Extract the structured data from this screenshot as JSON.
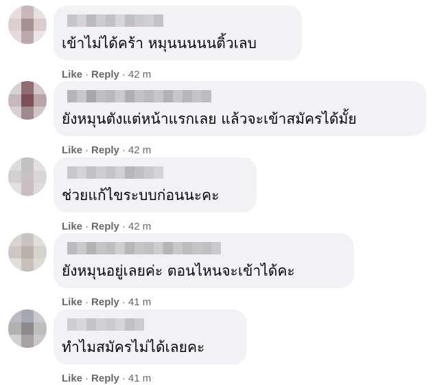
{
  "comments": [
    {
      "text": "เข้าไม่ได้คร้า หมุนนนนนติ้วเลบ",
      "like": "Like",
      "reply": "Reply",
      "time": "42 m",
      "avatar_colors": [
        "#e8dcdc",
        "#c9b7b9",
        "#e6e1e1",
        "#dccfd0",
        "#a78f94",
        "#d8cccd",
        "#e4dcdc",
        "#bca9ac",
        "#ebe6e6"
      ],
      "name_colors": [
        "#c8c4cc",
        "#d6d2d8",
        "#bcb8c2",
        "#cfcbd3",
        "#c4c0c8",
        "#d8d4da",
        "#c2bec6",
        "#cdc9cf",
        "#d3cfd6",
        "#c6c2ca"
      ]
    },
    {
      "text": "ยังหมุนตังแต่หน้าแรกเลย แล้วจะเข้าสมัครได้มั้ย",
      "like": "Like",
      "reply": "Reply",
      "time": "42 m",
      "avatar_colors": [
        "#d9d2d2",
        "#8f6b72",
        "#d1c8c9",
        "#c7b9bb",
        "#7c4f58",
        "#b7a5a8",
        "#d9d0d1",
        "#9e8a8e",
        "#cfc6c7"
      ],
      "name_colors": [
        "#b7b3bb",
        "#cac6ce",
        "#a9a5ad",
        "#c1bdc5",
        "#bbb7bf",
        "#ccc8d0",
        "#b1adb5",
        "#c4c0c8",
        "#bdb9c1",
        "#c8c4cc",
        "#b5b1b9",
        "#c9c5cd",
        "#b9b5bd",
        "#c6c2ca",
        "#bfbbc3"
      ]
    },
    {
      "text": "ช่วยแก้ไขระบบก่อนนะคะ",
      "like": "Like",
      "reply": "Reply",
      "time": "42 m",
      "avatar_colors": [
        "#dcdcdc",
        "#c2c0c1",
        "#e2e0e0",
        "#d2cfd0",
        "#c8c2c3",
        "#dad6d6",
        "#e4e0e0",
        "#c9bfc1",
        "#e0dada"
      ],
      "name_colors": [
        "#c9c7cb",
        "#d5d3d7",
        "#c3c1c5",
        "#cfcdd1",
        "#c6c4c8",
        "#d2d0d4",
        "#b8b6ba",
        "#c1bfc3",
        "#cbc9cd",
        "#d6d4d8"
      ]
    },
    {
      "text": "ยังหมุนอยู่เลยค่ะ ตอนไหนจะเข้าได้คะ",
      "like": "Like",
      "reply": "Reply",
      "time": "41 m",
      "avatar_colors": [
        "#d8d4d0",
        "#c9c3bd",
        "#e1ddd9",
        "#cfc8c2",
        "#b9b0a8",
        "#d7d1cb",
        "#e2deda",
        "#c7bfb8",
        "#dfdad5"
      ],
      "name_colors": [
        "#bcbabd",
        "#cbc9cc",
        "#b4b2b5",
        "#c5c3c6",
        "#bebcbf",
        "#d0ced1",
        "#b8b6b9",
        "#c7c5c8",
        "#c1bfc2",
        "#cecccf",
        "#b6b4b7",
        "#c9c7ca",
        "#bdbbbe",
        "#c6c4c7",
        "#c0bec1",
        "#cbc9cc"
      ]
    },
    {
      "text": "ทำไมสมัครไม่ได้เลยคะ",
      "like": "Like",
      "reply": "Reply",
      "time": "41 m",
      "avatar_colors": [
        "#b9bcc2",
        "#a5a9b1",
        "#c8cbd0",
        "#b3b0b0",
        "#8d8a8b",
        "#bfbcbc",
        "#d3d0d0",
        "#a7a3a3",
        "#cbc8c8"
      ],
      "name_colors": [
        "#cfcdd1",
        "#d9d7db",
        "#c6c4c8",
        "#d2d0d4",
        "#cbc9cd",
        "#d6d4d8",
        "#c2c0c4",
        "#cdcbcf"
      ]
    }
  ]
}
